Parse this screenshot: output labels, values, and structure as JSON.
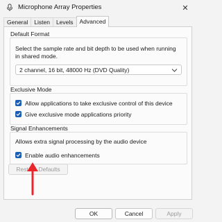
{
  "window": {
    "title": "Microphone Array Properties",
    "close_glyph": "✕"
  },
  "tabs": [
    {
      "label": "General"
    },
    {
      "label": "Listen"
    },
    {
      "label": "Levels"
    },
    {
      "label": "Advanced",
      "active": true
    }
  ],
  "default_format": {
    "title": "Default Format",
    "description": "Select the sample rate and bit depth to be used when running in shared mode.",
    "selected": "2 channel, 16 bit, 48000 Hz (DVD Quality)"
  },
  "exclusive_mode": {
    "title": "Exclusive Mode",
    "options": [
      {
        "label": "Allow applications to take exclusive control of this device",
        "checked": true
      },
      {
        "label": "Give exclusive mode applications priority",
        "checked": true
      }
    ]
  },
  "signal_enhancements": {
    "title": "Signal Enhancements",
    "description": "Allows extra signal processing by the audio device",
    "option": {
      "label": "Enable audio enhancements",
      "checked": true
    }
  },
  "buttons": {
    "restore": "Restore Defaults",
    "ok": "OK",
    "cancel": "Cancel",
    "apply": "Apply"
  },
  "colors": {
    "accent": "#1a5fb4",
    "annotation_arrow": "#e8262b"
  },
  "icons": {
    "title": "microphone-icon",
    "close": "close-icon",
    "dropdown": "chevron-down-icon",
    "annotation": "red-arrow-icon"
  }
}
